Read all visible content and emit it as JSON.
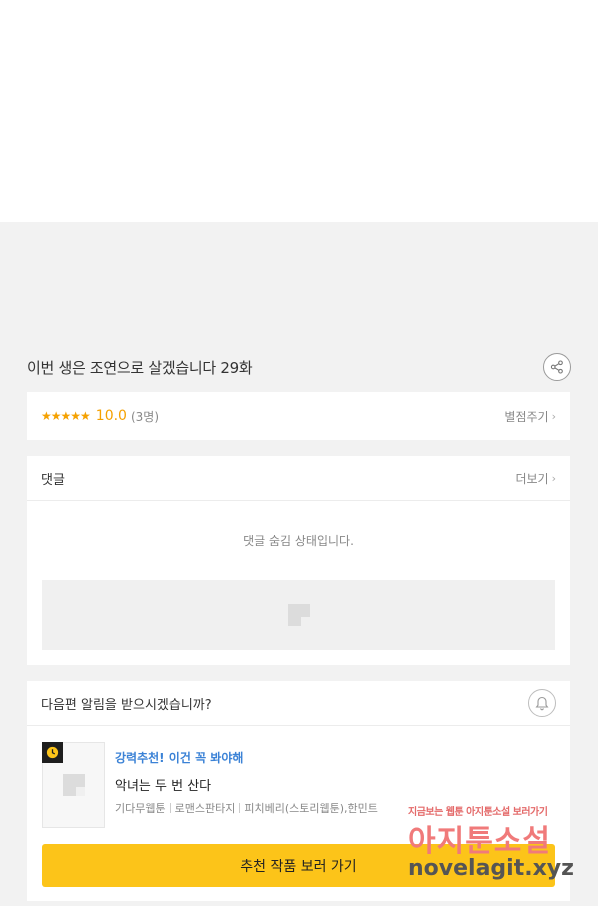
{
  "episode": {
    "title": "이번 생은 조연으로 살겠습니다 29화"
  },
  "rating": {
    "stars": "★★★★★",
    "score": "10.0",
    "count": "(3명)",
    "rate_link": "별점주기"
  },
  "comments": {
    "title": "댓글",
    "more_link": "더보기",
    "hidden_message": "댓글 숨김 상태입니다."
  },
  "notify": {
    "question": "다음편 알림을 받으시겠습니까?",
    "recommend": {
      "tag": "강력추천! 이건 꼭 봐야해",
      "title": "악녀는 두 번 산다",
      "meta": [
        "기다무웹툰",
        "로맨스판타지",
        "피치베리(스토리웹툰),한민트"
      ]
    },
    "button_label": "추천 작품 보러 가기"
  },
  "watermark": {
    "top": "지금보는 웹툰 아지툰소설 보러가기",
    "main": "아지툰소설",
    "url": "novelagit.xyz"
  },
  "colors": {
    "accent_yellow": "#fcc419",
    "star_orange": "#f5a100",
    "link_blue": "#3b82d6"
  }
}
